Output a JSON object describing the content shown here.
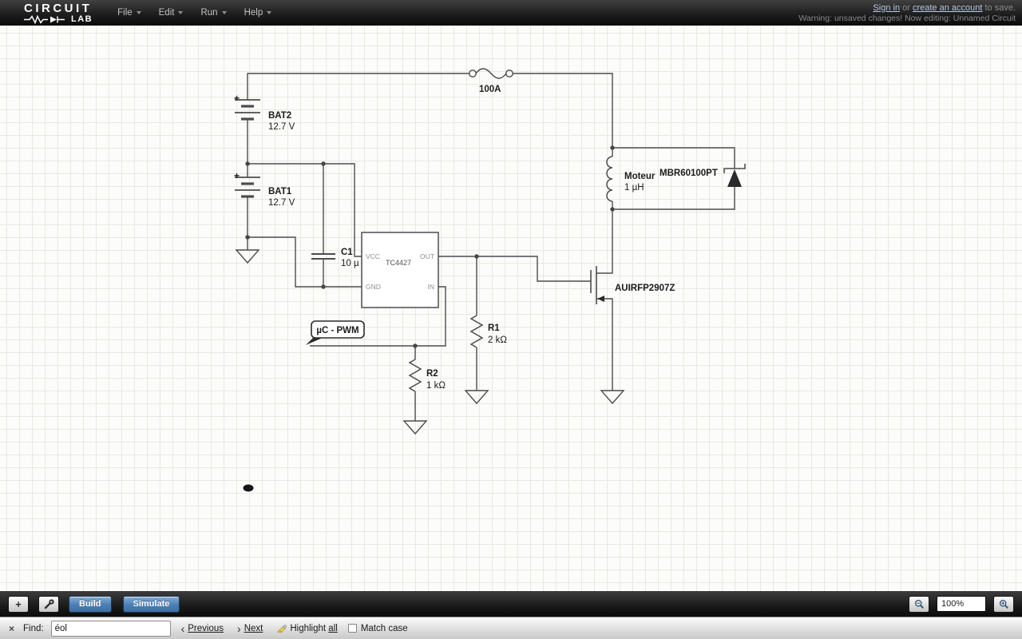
{
  "topbar": {
    "logo_line1": "CIRCUIT",
    "logo_line2": "LAB",
    "menus": [
      {
        "label": "File"
      },
      {
        "label": "Edit"
      },
      {
        "label": "Run"
      },
      {
        "label": "Help"
      }
    ],
    "signin": {
      "sign_in": "Sign in",
      "or": " or ",
      "create_account": "create an account",
      "to_save": " to save."
    },
    "warning": "Warning: unsaved changes! Now editing: Unnamed Circuit"
  },
  "schematic": {
    "bat2": {
      "plus": "+",
      "name": "BAT2",
      "value": "12.7 V"
    },
    "bat1": {
      "plus": "+",
      "name": "BAT1",
      "value": "12.7 V"
    },
    "fuse": {
      "value": "100A"
    },
    "inductor": {
      "name": "Moteur",
      "value": "1 µH"
    },
    "diode": {
      "name": "MBR60100PT"
    },
    "cap": {
      "name": "C1",
      "value": "10 µ"
    },
    "ic": {
      "name": "TC4427",
      "pin_vcc": "VCC",
      "pin_out": "OUT",
      "pin_gnd": "GND",
      "pin_in": "IN"
    },
    "pwm": {
      "label": "µC - PWM"
    },
    "r1": {
      "name": "R1",
      "value": "2 kΩ"
    },
    "r2": {
      "name": "R2",
      "value": "1 kΩ"
    },
    "mosfet": {
      "name": "AUIRFP2907Z"
    }
  },
  "toolbar": {
    "add_label": "+",
    "build_label": "Build",
    "simulate_label": "Simulate",
    "zoom_value": "100%"
  },
  "findbar": {
    "close_glyph": "×",
    "label": "Find:",
    "query": "éol",
    "prev_chevron": "‹",
    "previous_label": "Previous",
    "next_chevron": "›",
    "next_label": "Next",
    "highlight_prefix": "Highlight ",
    "highlight_accesskey": "all",
    "match_case_label": "Match case"
  }
}
